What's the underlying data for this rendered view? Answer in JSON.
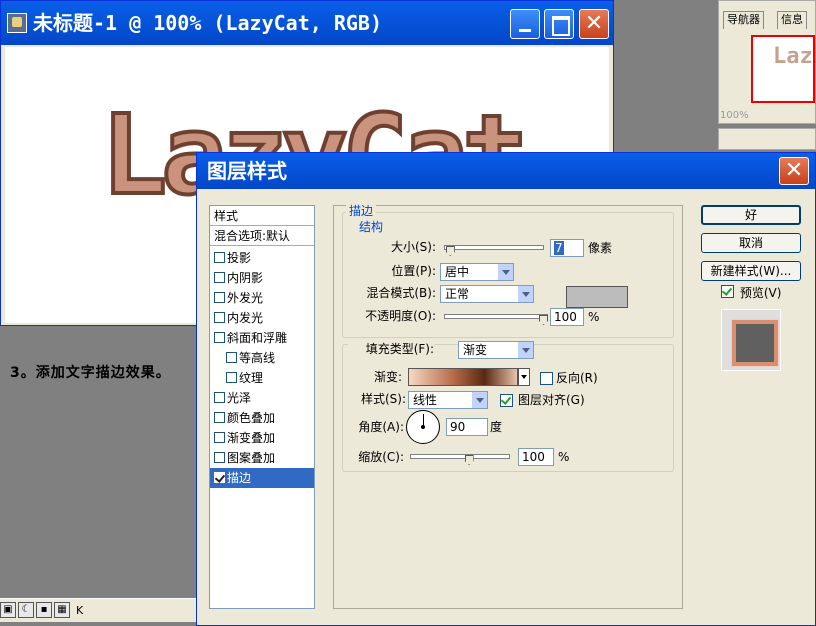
{
  "document_window": {
    "title": "未标题-1 @ 100% (LazyCat, RGB)",
    "canvas_text": "LazyCat"
  },
  "side_panel": {
    "tabs": [
      "导航器",
      "信息"
    ],
    "thumb_text": "Laz",
    "zoom": "100%"
  },
  "step_text": "3。添加文字描边效果。",
  "status_bar": {
    "text": "K"
  },
  "dialog": {
    "title": "图层样式",
    "style_list": {
      "header": "样式",
      "blend_options": "混合选项:默认",
      "items": [
        {
          "label": "投影",
          "checked": false
        },
        {
          "label": "内阴影",
          "checked": false
        },
        {
          "label": "外发光",
          "checked": false
        },
        {
          "label": "内发光",
          "checked": false
        },
        {
          "label": "斜面和浮雕",
          "checked": false
        },
        {
          "label": "等高线",
          "checked": false
        },
        {
          "label": "纹理",
          "checked": false
        },
        {
          "label": "光泽",
          "checked": false
        },
        {
          "label": "颜色叠加",
          "checked": false
        },
        {
          "label": "渐变叠加",
          "checked": false
        },
        {
          "label": "图案叠加",
          "checked": false
        },
        {
          "label": "描边",
          "checked": true
        }
      ]
    },
    "stroke": {
      "section_title": "描边",
      "structure_title": "结构",
      "size_label": "大小(S):",
      "size_value": "7",
      "size_unit": "像素",
      "size_level": 0.02,
      "position_label": "位置(P):",
      "position_value": "居中",
      "blend_mode_label": "混合模式(B):",
      "blend_mode_value": "正常",
      "opacity_label": "不透明度(O):",
      "opacity_value": "100",
      "opacity_unit": "%",
      "opacity_level": 1.0,
      "fill_type_label": "填充类型(F):",
      "fill_type_value": "渐变",
      "gradient_label": "渐变:",
      "reverse_label": "反向(R)",
      "reverse_checked": false,
      "style_label": "样式(S):",
      "style_value": "线性",
      "align_label": "图层对齐(G)",
      "align_checked": true,
      "angle_label": "角度(A):",
      "angle_value": "90",
      "angle_unit": "度",
      "scale_label": "缩放(C):",
      "scale_value": "100",
      "scale_unit": "%",
      "scale_level": 0.6
    },
    "buttons": {
      "ok": "好",
      "cancel": "取消",
      "new_style": "新建样式(W)..."
    },
    "preview": {
      "label": "预览(V)",
      "checked": true
    }
  },
  "colors": {
    "titlebar": "#0553d8",
    "selection": "#316ac5",
    "stroke_color_swatch": "#bcbcbc",
    "group_label": "#0046d5"
  }
}
